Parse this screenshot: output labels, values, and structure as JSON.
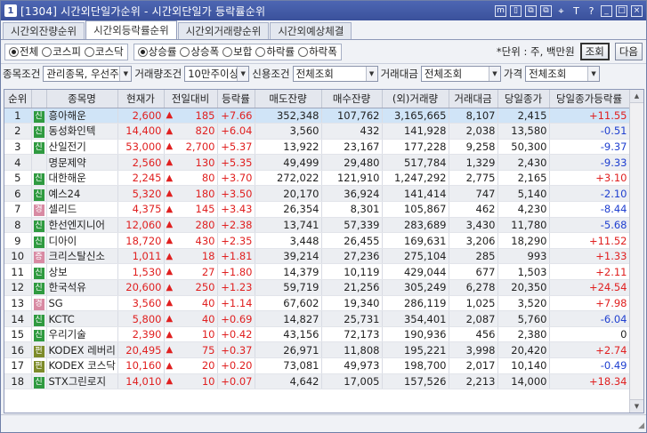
{
  "window": {
    "number": "1",
    "title": "[1304] 시간외단일가순위 - 시간외단일가 등락률순위"
  },
  "title_icons": [
    "m",
    "▯",
    "⧉",
    "⧉",
    "⌖",
    "T",
    "?",
    "_",
    "□",
    "×"
  ],
  "tabs": [
    {
      "label": "시간외잔량순위",
      "active": false
    },
    {
      "label": "시간외등락률순위",
      "active": true
    },
    {
      "label": "시간외거래량순위",
      "active": false
    },
    {
      "label": "시간외예상체결",
      "active": false
    }
  ],
  "market_radios": [
    {
      "label": "전체",
      "on": true
    },
    {
      "label": "코스피",
      "on": false
    },
    {
      "label": "코스닥",
      "on": false
    }
  ],
  "sort_radios": [
    {
      "label": "상승률",
      "on": true
    },
    {
      "label": "상승폭",
      "on": false
    },
    {
      "label": "보합",
      "on": false
    },
    {
      "label": "하락률",
      "on": false
    },
    {
      "label": "하락폭",
      "on": false
    }
  ],
  "unit_text": "*단위 : 주, 백만원",
  "query_button": "조회",
  "next_button": "다음",
  "filters": {
    "stock_label": "종목조건",
    "stock_value": "관리종목, 우선주",
    "volume_label": "거래량조건",
    "volume_value": "10만주이상",
    "credit_label": "신용조건",
    "credit_value": "전체조회",
    "amount_label": "거래대금",
    "amount_value": "전체조회",
    "price_label": "가격",
    "price_value": "전체조회"
  },
  "columns": [
    "순위",
    "",
    "종목명",
    "현재가",
    "전일대비",
    "등락률",
    "매도잔량",
    "매수잔량",
    "(외)거래량",
    "거래대금",
    "당일종가",
    "당일종가등락률"
  ],
  "rows": [
    {
      "rank": "1",
      "badge": "신",
      "badge_color": "green",
      "name": "흥아해운",
      "price": "2,600",
      "chg": "185",
      "rate": "+7.66",
      "ask": "352,348",
      "bid": "107,762",
      "volume": "3,165,665",
      "amount": "8,107",
      "close": "2,415",
      "close_rate": "+11.55",
      "close_dir": "up"
    },
    {
      "rank": "2",
      "badge": "신",
      "badge_color": "green",
      "name": "동성화인텍",
      "price": "14,400",
      "chg": "820",
      "rate": "+6.04",
      "ask": "3,560",
      "bid": "432",
      "volume": "141,928",
      "amount": "2,038",
      "close": "13,580",
      "close_rate": "-0.51",
      "close_dir": "down"
    },
    {
      "rank": "3",
      "badge": "신",
      "badge_color": "green",
      "name": "산일전기",
      "price": "53,000",
      "chg": "2,700",
      "rate": "+5.37",
      "ask": "13,922",
      "bid": "23,167",
      "volume": "177,228",
      "amount": "9,258",
      "close": "50,300",
      "close_rate": "-9.37",
      "close_dir": "down"
    },
    {
      "rank": "4",
      "badge": "",
      "badge_color": "",
      "name": "명문제약",
      "price": "2,560",
      "chg": "130",
      "rate": "+5.35",
      "ask": "49,499",
      "bid": "29,480",
      "volume": "517,784",
      "amount": "1,329",
      "close": "2,430",
      "close_rate": "-9.33",
      "close_dir": "down"
    },
    {
      "rank": "5",
      "badge": "신",
      "badge_color": "green",
      "name": "대한해운",
      "price": "2,245",
      "chg": "80",
      "rate": "+3.70",
      "ask": "272,022",
      "bid": "121,910",
      "volume": "1,247,292",
      "amount": "2,775",
      "close": "2,165",
      "close_rate": "+3.10",
      "close_dir": "up"
    },
    {
      "rank": "6",
      "badge": "신",
      "badge_color": "green",
      "name": "예스24",
      "price": "5,320",
      "chg": "180",
      "rate": "+3.50",
      "ask": "20,170",
      "bid": "36,924",
      "volume": "141,414",
      "amount": "747",
      "close": "5,140",
      "close_rate": "-2.10",
      "close_dir": "down"
    },
    {
      "rank": "7",
      "badge": "경",
      "badge_color": "pink",
      "name": "셀리드",
      "price": "4,375",
      "chg": "145",
      "rate": "+3.43",
      "ask": "26,354",
      "bid": "8,301",
      "volume": "105,867",
      "amount": "462",
      "close": "4,230",
      "close_rate": "-8.44",
      "close_dir": "down"
    },
    {
      "rank": "8",
      "badge": "신",
      "badge_color": "green",
      "name": "한선엔지니어",
      "price": "12,060",
      "chg": "280",
      "rate": "+2.38",
      "ask": "13,741",
      "bid": "57,339",
      "volume": "283,689",
      "amount": "3,430",
      "close": "11,780",
      "close_rate": "-5.68",
      "close_dir": "down"
    },
    {
      "rank": "9",
      "badge": "신",
      "badge_color": "green",
      "name": "디아이",
      "price": "18,720",
      "chg": "430",
      "rate": "+2.35",
      "ask": "3,448",
      "bid": "26,455",
      "volume": "169,631",
      "amount": "3,206",
      "close": "18,290",
      "close_rate": "+11.52",
      "close_dir": "up"
    },
    {
      "rank": "10",
      "badge": "증",
      "badge_color": "pink",
      "name": "크리스탈신소",
      "price": "1,011",
      "chg": "18",
      "rate": "+1.81",
      "ask": "39,214",
      "bid": "27,236",
      "volume": "275,104",
      "amount": "285",
      "close": "993",
      "close_rate": "+1.33",
      "close_dir": "up"
    },
    {
      "rank": "11",
      "badge": "신",
      "badge_color": "green",
      "name": "상보",
      "price": "1,530",
      "chg": "27",
      "rate": "+1.80",
      "ask": "14,379",
      "bid": "10,119",
      "volume": "429,044",
      "amount": "677",
      "close": "1,503",
      "close_rate": "+2.11",
      "close_dir": "up"
    },
    {
      "rank": "12",
      "badge": "신",
      "badge_color": "green",
      "name": "한국석유",
      "price": "20,600",
      "chg": "250",
      "rate": "+1.23",
      "ask": "59,719",
      "bid": "21,256",
      "volume": "305,249",
      "amount": "6,278",
      "close": "20,350",
      "close_rate": "+24.54",
      "close_dir": "up"
    },
    {
      "rank": "13",
      "badge": "경",
      "badge_color": "pink",
      "name": "SG",
      "price": "3,560",
      "chg": "40",
      "rate": "+1.14",
      "ask": "67,602",
      "bid": "19,340",
      "volume": "286,119",
      "amount": "1,025",
      "close": "3,520",
      "close_rate": "+7.98",
      "close_dir": "up"
    },
    {
      "rank": "14",
      "badge": "신",
      "badge_color": "green",
      "name": "KCTC",
      "price": "5,800",
      "chg": "40",
      "rate": "+0.69",
      "ask": "14,827",
      "bid": "25,731",
      "volume": "354,401",
      "amount": "2,087",
      "close": "5,760",
      "close_rate": "-6.04",
      "close_dir": "down"
    },
    {
      "rank": "15",
      "badge": "신",
      "badge_color": "green",
      "name": "우리기술",
      "price": "2,390",
      "chg": "10",
      "rate": "+0.42",
      "ask": "43,156",
      "bid": "72,173",
      "volume": "190,936",
      "amount": "456",
      "close": "2,380",
      "close_rate": "0",
      "close_dir": "flat"
    },
    {
      "rank": "16",
      "badge": "펀",
      "badge_color": "olive",
      "name": "KODEX 레버리",
      "price": "20,495",
      "chg": "75",
      "rate": "+0.37",
      "ask": "26,971",
      "bid": "11,808",
      "volume": "195,221",
      "amount": "3,998",
      "close": "20,420",
      "close_rate": "+2.74",
      "close_dir": "up"
    },
    {
      "rank": "17",
      "badge": "펀",
      "badge_color": "olive",
      "name": "KODEX 코스닥",
      "price": "10,160",
      "chg": "20",
      "rate": "+0.20",
      "ask": "73,081",
      "bid": "49,973",
      "volume": "198,700",
      "amount": "2,017",
      "close": "10,140",
      "close_rate": "-0.49",
      "close_dir": "down"
    },
    {
      "rank": "18",
      "badge": "신",
      "badge_color": "green",
      "name": "STX그린로지",
      "price": "14,010",
      "chg": "10",
      "rate": "+0.07",
      "ask": "4,642",
      "bid": "17,005",
      "volume": "157,526",
      "amount": "2,213",
      "close": "14,000",
      "close_rate": "+18.34",
      "close_dir": "up"
    }
  ]
}
